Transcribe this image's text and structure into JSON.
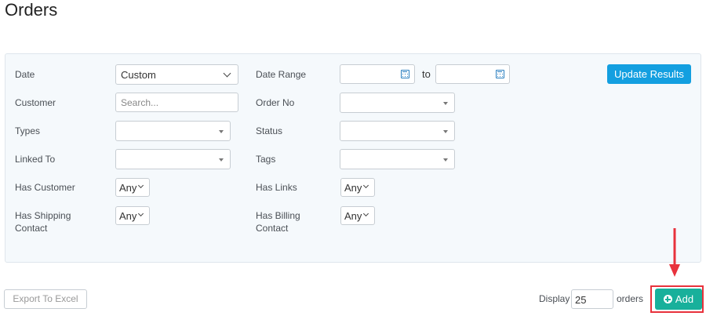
{
  "page": {
    "title": "Orders"
  },
  "filters": {
    "date": {
      "label": "Date",
      "value": "Custom"
    },
    "date_range": {
      "label": "Date Range",
      "from": "",
      "to_text": "to",
      "to": ""
    },
    "customer": {
      "label": "Customer",
      "placeholder": "Search..."
    },
    "order_no": {
      "label": "Order No",
      "value": ""
    },
    "types": {
      "label": "Types",
      "value": ""
    },
    "status": {
      "label": "Status",
      "value": ""
    },
    "linked_to": {
      "label": "Linked To",
      "value": ""
    },
    "tags": {
      "label": "Tags",
      "value": ""
    },
    "has_customer": {
      "label": "Has Customer",
      "value": "Any"
    },
    "has_links": {
      "label": "Has Links",
      "value": "Any"
    },
    "has_shipping_contact": {
      "label_line1": "Has Shipping",
      "label_line2": "Contact",
      "value": "Any"
    },
    "has_billing_contact": {
      "label_line1": "Has Billing",
      "label_line2": "Contact",
      "value": "Any"
    },
    "update_button": "Update Results"
  },
  "footer": {
    "export_button": "Export To Excel",
    "display_label": "Display",
    "display_value": "25",
    "orders_label": "orders",
    "add_button": "Add"
  },
  "colors": {
    "primary": "#139fe0",
    "add": "#18b09b",
    "highlight": "#e8323c",
    "panel_bg": "#f5f9fc"
  }
}
